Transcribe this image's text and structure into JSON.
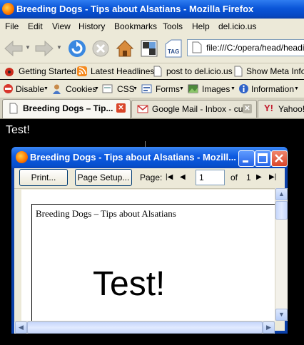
{
  "window": {
    "title": "Breeding Dogs - Tips about Alsatians - Mozilla Firefox"
  },
  "menu": [
    "File",
    "Edit",
    "View",
    "History",
    "Bookmarks",
    "Tools",
    "Help",
    "del.icio.us"
  ],
  "nav": {
    "url": "file:///C:/opera/head/headin",
    "tag_label": "TAG"
  },
  "bookmarks": [
    "Getting Started",
    "Latest Headlines",
    "post to del.icio.us",
    "Show Meta Info"
  ],
  "devtools": [
    "Disable",
    "Cookies",
    "CSS",
    "Forms",
    "Images",
    "Information"
  ],
  "tabs": [
    {
      "label": "Breeding Dogs – Tip..."
    },
    {
      "label": "Google Mail - Inbox - cu..."
    },
    {
      "label": "Yahoo!"
    }
  ],
  "page": {
    "text": "Test!"
  },
  "print_preview": {
    "title": "Breeding Dogs - Tips about Alsatians - Mozill...",
    "print_button": "Print...",
    "page_setup_button": "Page Setup...",
    "page_label": "Page:",
    "page_value": "1",
    "of_label": "of",
    "total_pages": "1",
    "paper_header": "Breeding Dogs – Tips about Alsatians",
    "paper_body": "Test!"
  },
  "colors": {
    "titlebar_blue": "#0a55d8",
    "chrome": "#ece9d8",
    "close_red": "#d9452a"
  }
}
